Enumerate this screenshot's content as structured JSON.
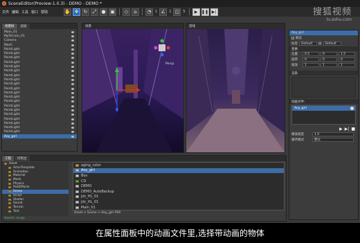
{
  "window": {
    "title": "SceneEditor(Preview-1.0.3) - DEMO - DEMO *"
  },
  "menu": [
    "文件",
    "编辑",
    "工具",
    "窗口",
    "帮助"
  ],
  "toolbar": {
    "num1": "1",
    "num2": "1",
    "num3": "5"
  },
  "watermark": {
    "line1": "搜狐视频",
    "line2": "tv.sohu.com"
  },
  "left_panel": {
    "tabs": [
      "场景树",
      "层级"
    ],
    "items": [
      "Main_01",
      "MyTerrain_01",
      "Camera",
      "Mesh",
      "PointLight",
      "PointLight",
      "PointLight",
      "PointLight",
      "PointLight",
      "PointLight",
      "PointLight",
      "PointLight",
      "PointLight",
      "PointLight",
      "PointLight",
      "PointLight",
      "PointLight",
      "PointLight",
      "PointLight",
      "PointLight",
      "PointLight",
      "PointLight",
      "PointLight",
      "PointLight",
      "Aoy_girl"
    ],
    "selected_index": 24
  },
  "viewport_left": {
    "title": "场景",
    "mode": "Persp"
  },
  "viewport_right": {
    "title": "游戏"
  },
  "properties": {
    "title": "Aoy_girl",
    "row_static": "静态",
    "tag_label": "标签",
    "tag_value": "Default",
    "layer_label": "层",
    "layer_value": "Default",
    "transform_section": "变换",
    "pos_label": "位置",
    "rot_label": "旋转",
    "scale_label": "缩放",
    "pos": [
      "0.5",
      "0",
      "1.5"
    ],
    "rot": [
      "0",
      "0",
      "0"
    ],
    "scale": [
      "1",
      "1",
      "1"
    ],
    "render_section": "渲染",
    "anim_section": "动画文件:",
    "anim_item": "Aoy_girl",
    "play_speed_label": "播放速度",
    "play_speed_value": "1.0",
    "loop_label": "循环模式",
    "loop_value": "默认"
  },
  "assets": {
    "tabs": [
      "工程",
      "控制台"
    ],
    "tree": [
      "Asset",
      "ActorTemplate",
      "Animation",
      "Material",
      "Mesh",
      "Physics",
      "PostEffects",
      "Scene",
      "Script",
      "Shader",
      "Sound",
      "Terrain",
      "Test"
    ],
    "tree_selected": 7,
    "files": [
      "aging_color",
      "Aoy_girl",
      "Box",
      "CD",
      "DEMO",
      "DEMO_AutoBackup",
      "Jdc_HL_01",
      "Jdc_HL_01",
      "Main_01"
    ],
    "file_selected": 1,
    "path": "Asset > Scene > Aoy_girl.FBX",
    "status": "Assert: no.go"
  },
  "caption": "在属性面板中的动画文件里,选择带动画的物体"
}
